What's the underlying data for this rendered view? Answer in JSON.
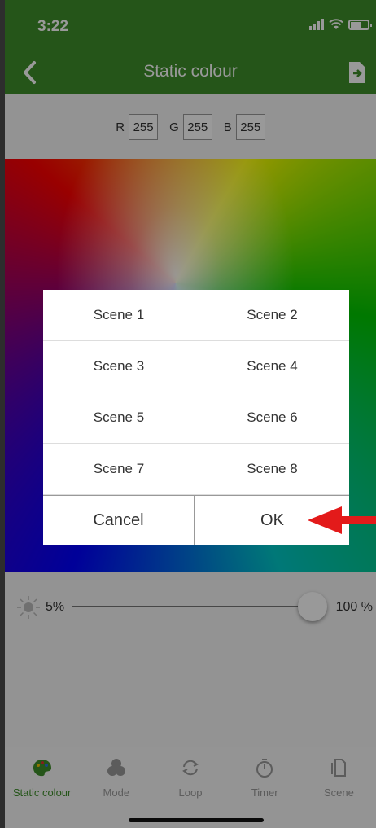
{
  "status_bar": {
    "time": "3:22"
  },
  "header": {
    "title": "Static colour",
    "back_icon": "chevron-left-icon",
    "export_icon": "export-file-icon"
  },
  "rgb": {
    "r_label": "R",
    "r_value": "255",
    "g_label": "G",
    "g_value": "255",
    "b_label": "B",
    "b_value": "255"
  },
  "brightness": {
    "min_label": "5%",
    "max_label": "100 %",
    "level_percent": 100
  },
  "dialog": {
    "scenes": [
      "Scene 1",
      "Scene 2",
      "Scene 3",
      "Scene 4",
      "Scene 5",
      "Scene 6",
      "Scene 7",
      "Scene 8"
    ],
    "cancel_label": "Cancel",
    "ok_label": "OK"
  },
  "tabs": [
    {
      "label": "Static colour",
      "icon": "palette-icon",
      "active": true
    },
    {
      "label": "Mode",
      "icon": "mode-circles-icon",
      "active": false
    },
    {
      "label": "Loop",
      "icon": "loop-icon",
      "active": false
    },
    {
      "label": "Timer",
      "icon": "timer-icon",
      "active": false
    },
    {
      "label": "Scene",
      "icon": "scene-icon",
      "active": false
    }
  ],
  "colors": {
    "accent_green": "#3e8e2b",
    "annotation_arrow": "#e31a1a"
  }
}
